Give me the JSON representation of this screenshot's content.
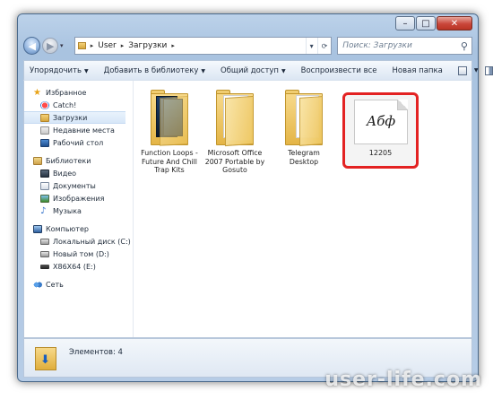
{
  "window": {
    "min_label": "–",
    "max_label": "□",
    "close_label": "✕"
  },
  "nav": {
    "back_label": "◀",
    "forward_label": "▶"
  },
  "address": {
    "segments": [
      "User",
      "Загрузки"
    ],
    "separator": "▸",
    "dropdown": "▾",
    "refresh": "⟳"
  },
  "search": {
    "placeholder": "Поиск: Загрузки",
    "icon": "search-icon"
  },
  "toolbar": {
    "items": [
      "Упорядочить",
      "Добавить в библиотеку",
      "Общий доступ",
      "Воспроизвести все",
      "Новая папка"
    ],
    "dropdown_marker": "▼"
  },
  "nav_pane": {
    "favorites": {
      "header": "Избранное",
      "items": [
        "Catch!",
        "Загрузки",
        "Недавние места",
        "Рабочий стол"
      ]
    },
    "libraries": {
      "header": "Библиотеки",
      "items": [
        "Видео",
        "Документы",
        "Изображения",
        "Музыка"
      ]
    },
    "computer": {
      "header": "Компьютер",
      "items": [
        "Локальный диск (C:)",
        "Новый том (D:)",
        "X86X64 (E:)"
      ]
    },
    "network": {
      "header": "Сеть"
    },
    "selected": "Загрузки"
  },
  "files": [
    {
      "name": "Function Loops - Future And Chill Trap Kits",
      "kind": "folder-cover"
    },
    {
      "name": "Microsoft Office 2007 Portable by Gosuto",
      "kind": "folder"
    },
    {
      "name": "Telegram Desktop",
      "kind": "folder-paper"
    },
    {
      "name": "12205",
      "kind": "font-file",
      "preview": "Абф",
      "highlighted": true
    }
  ],
  "details": {
    "count_label": "Элементов: 4"
  },
  "watermark": "user-life.com",
  "colors": {
    "highlight": "#e32222",
    "accent": "#2f6fc9"
  }
}
